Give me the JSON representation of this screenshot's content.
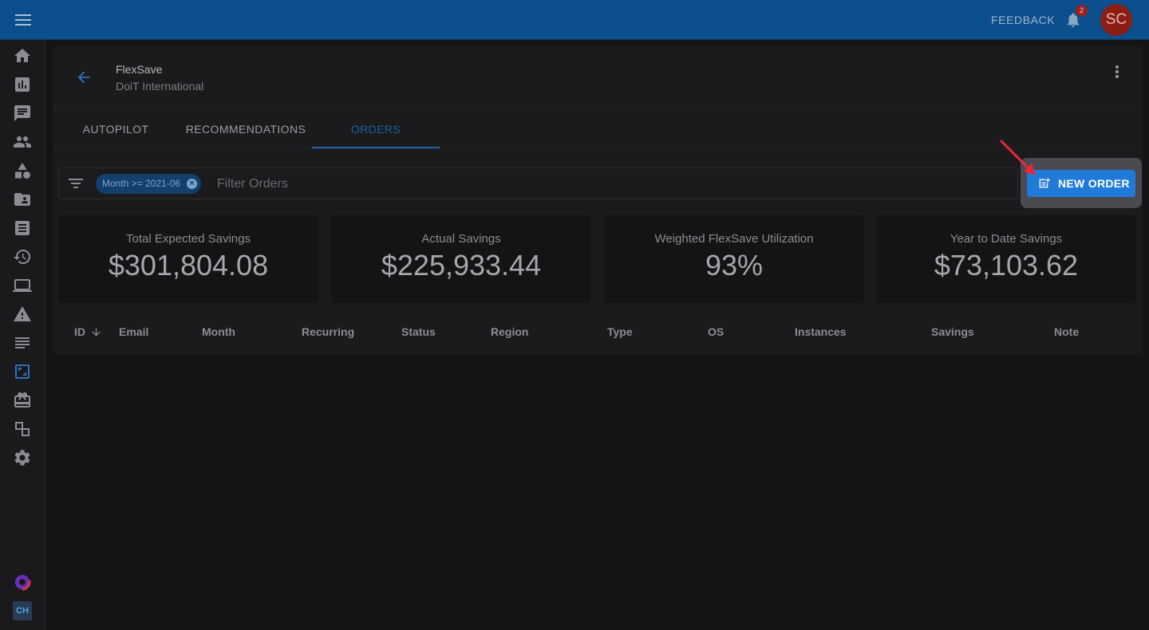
{
  "topbar": {
    "feedback_label": "FEEDBACK",
    "notification_count": "2",
    "avatar_initials": "SC"
  },
  "sidebar": {
    "items": [
      "home-icon",
      "analytics-icon",
      "chat-icon",
      "people-icon",
      "shapes-icon",
      "folder-account-icon",
      "receipt-icon",
      "history-icon",
      "laptop-icon",
      "warning-icon",
      "list-icon",
      "flexsave-icon",
      "marketplace-icon",
      "integrations-icon",
      "settings-icon"
    ],
    "active_item": "flexsave-icon",
    "bottom": {
      "logo_text": "CH"
    }
  },
  "header": {
    "title": "FlexSave",
    "subtitle": "DoiT International"
  },
  "tabs": [
    {
      "label": "AUTOPILOT",
      "active": false
    },
    {
      "label": "RECOMMENDATIONS",
      "active": false
    },
    {
      "label": "ORDERS",
      "active": true
    }
  ],
  "filter": {
    "chip_label": "Month >= 2021-06",
    "placeholder": "Filter Orders"
  },
  "actions": {
    "new_order_label": "NEW ORDER"
  },
  "summary": [
    {
      "label": "Total Expected Savings",
      "value": "$301,804.08"
    },
    {
      "label": "Actual Savings",
      "value": "$225,933.44"
    },
    {
      "label": "Weighted FlexSave Utilization",
      "value": "93%"
    },
    {
      "label": "Year to Date Savings",
      "value": "$73,103.62"
    }
  ],
  "table": {
    "columns": [
      "ID",
      "Email",
      "Month",
      "Recurring",
      "Status",
      "Region",
      "Type",
      "OS",
      "Instances",
      "Savings",
      "Note"
    ],
    "sort_column": "ID",
    "sort_direction": "descending"
  },
  "colors": {
    "appbar": "#0b4f8c",
    "accent": "#1f7ad8",
    "avatar": "#8b1d14",
    "annotation_arrow": "#e8283a"
  }
}
